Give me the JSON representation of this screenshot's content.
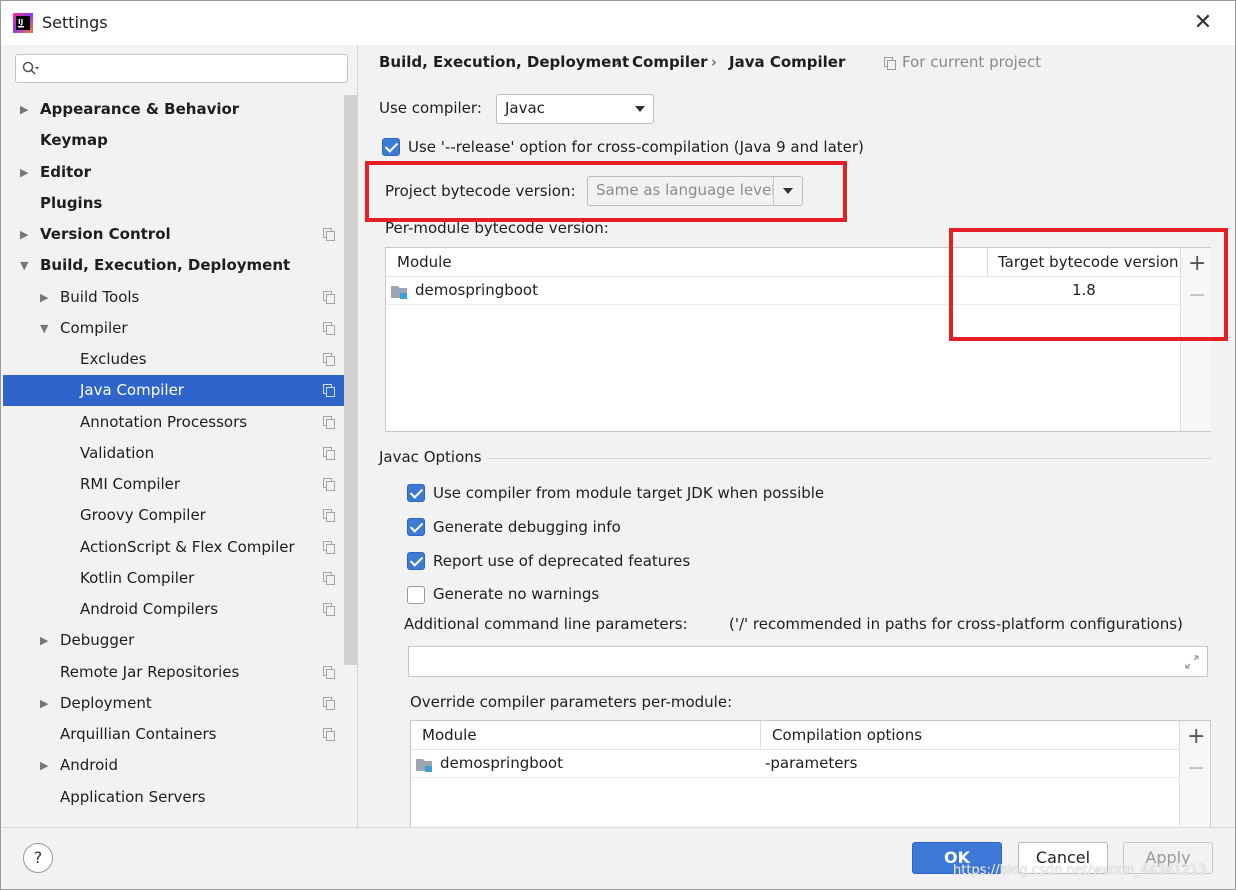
{
  "window": {
    "title": "Settings",
    "close_glyph": "✕",
    "app_icon": "intellij-idea-icon"
  },
  "search": {
    "placeholder": ""
  },
  "sidebar": {
    "items": [
      {
        "label": "Appearance & Behavior",
        "arrow": "▶",
        "bold": true
      },
      {
        "label": "Keymap",
        "arrow": "",
        "bold": true
      },
      {
        "label": "Editor",
        "arrow": "▶",
        "bold": true
      },
      {
        "label": "Plugins",
        "arrow": "",
        "bold": true
      },
      {
        "label": "Version Control",
        "arrow": "▶",
        "bold": true
      },
      {
        "label": "Build, Execution, Deployment",
        "arrow": "▼",
        "bold": true
      },
      {
        "label": "Build Tools",
        "arrow": "▶",
        "bold": false
      },
      {
        "label": "Compiler",
        "arrow": "▼",
        "bold": false
      },
      {
        "label": "Excludes",
        "arrow": "",
        "bold": false
      },
      {
        "label": "Java Compiler",
        "arrow": "",
        "bold": false,
        "selected": true
      },
      {
        "label": "Annotation Processors",
        "arrow": "",
        "bold": false
      },
      {
        "label": "Validation",
        "arrow": "",
        "bold": false
      },
      {
        "label": "RMI Compiler",
        "arrow": "",
        "bold": false
      },
      {
        "label": "Groovy Compiler",
        "arrow": "",
        "bold": false
      },
      {
        "label": "ActionScript & Flex Compiler",
        "arrow": "",
        "bold": false
      },
      {
        "label": "Kotlin Compiler",
        "arrow": "",
        "bold": false
      },
      {
        "label": "Android Compilers",
        "arrow": "",
        "bold": false
      },
      {
        "label": "Debugger",
        "arrow": "▶",
        "bold": false
      },
      {
        "label": "Remote Jar Repositories",
        "arrow": "",
        "bold": false
      },
      {
        "label": "Deployment",
        "arrow": "▶",
        "bold": false
      },
      {
        "label": "Arquillian Containers",
        "arrow": "",
        "bold": false
      },
      {
        "label": "Android",
        "arrow": "▶",
        "bold": false
      },
      {
        "label": "Application Servers",
        "arrow": "",
        "bold": false
      }
    ]
  },
  "breadcrumb": {
    "parts": [
      "Build, Execution, Deployment",
      "Compiler",
      "Java Compiler"
    ],
    "separator": "›",
    "scope": "For current project"
  },
  "compiler": {
    "use_compiler_label": "Use compiler:",
    "use_compiler_value": "Javac",
    "release_option_label": "Use '--release' option for cross-compilation (Java 9 and later)",
    "release_option_checked": true,
    "bytecode_label": "Project bytecode version:",
    "bytecode_value": "Same as language level",
    "per_module_label": "Per-module bytecode version:"
  },
  "module_table": {
    "headers": [
      "Module",
      "Target bytecode version"
    ],
    "rows": [
      {
        "module": "demospringboot",
        "version": "1.8"
      }
    ],
    "add_glyph": "+",
    "remove_glyph": "−"
  },
  "javac": {
    "section_title": "Javac Options",
    "options": [
      {
        "label": "Use compiler from module target JDK when possible",
        "checked": true
      },
      {
        "label": "Generate debugging info",
        "checked": true
      },
      {
        "label": "Report use of deprecated features",
        "checked": true
      },
      {
        "label": "Generate no warnings",
        "checked": false
      }
    ],
    "cmdline_label": "Additional command line parameters:",
    "cmdline_hint": "('/' recommended in paths for cross-platform configurations)",
    "cmdline_value": "",
    "override_label": "Override compiler parameters per-module:"
  },
  "override_table": {
    "headers": [
      "Module",
      "Compilation options"
    ],
    "rows": [
      {
        "module": "demospringboot",
        "options": "-parameters"
      }
    ]
  },
  "footer": {
    "help": "?",
    "ok": "OK",
    "cancel": "Cancel",
    "apply": "Apply"
  },
  "watermark": "https://blog.csdn.net/weixin_44341213",
  "colors": {
    "selection": "#2f65ca",
    "highlight": "#e61e26",
    "checkbox": "#3d7ad1"
  }
}
